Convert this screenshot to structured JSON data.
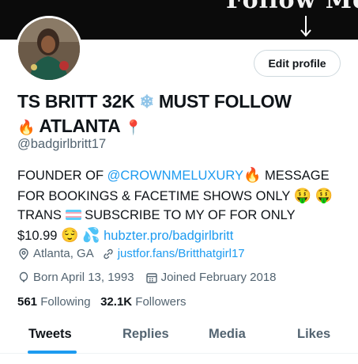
{
  "banner": {
    "text": "Follow Me"
  },
  "profile": {
    "edit_label": "Edit profile",
    "name_part1": "TS BRITT 32K",
    "name_part2": "MUST FOLLOW",
    "name_part3": "ATLANTA",
    "handle": "@badgirlbritt17"
  },
  "bio": {
    "l1_a": "FOUNDER OF ",
    "l1_link": "@CROWNMELUXURY",
    "l1_b": " MESSAGE",
    "l2": "FOR BOOKINGS & FACETIME SHOWS ONLY",
    "l3_a": "TRANS",
    "l3_b": "SUBSCRIBE TO MY OF FOR ONLY",
    "l4_a": "$10.99",
    "l4_link": "hubzter.pro/badgirlbritt"
  },
  "meta": {
    "location": "Atlanta, GA",
    "website": "justfor.fans/Britthatgirl17",
    "born": "Born April 13, 1993",
    "joined": "Joined February 2018"
  },
  "stats": {
    "following_count": "561",
    "following_label": "Following",
    "followers_count": "32.1K",
    "followers_label": "Followers"
  },
  "tabs": [
    "Tweets",
    "Replies",
    "Media",
    "Likes"
  ],
  "colors": {
    "accent": "#1d9bf0",
    "text": "#0f1419",
    "muted": "#536471"
  }
}
